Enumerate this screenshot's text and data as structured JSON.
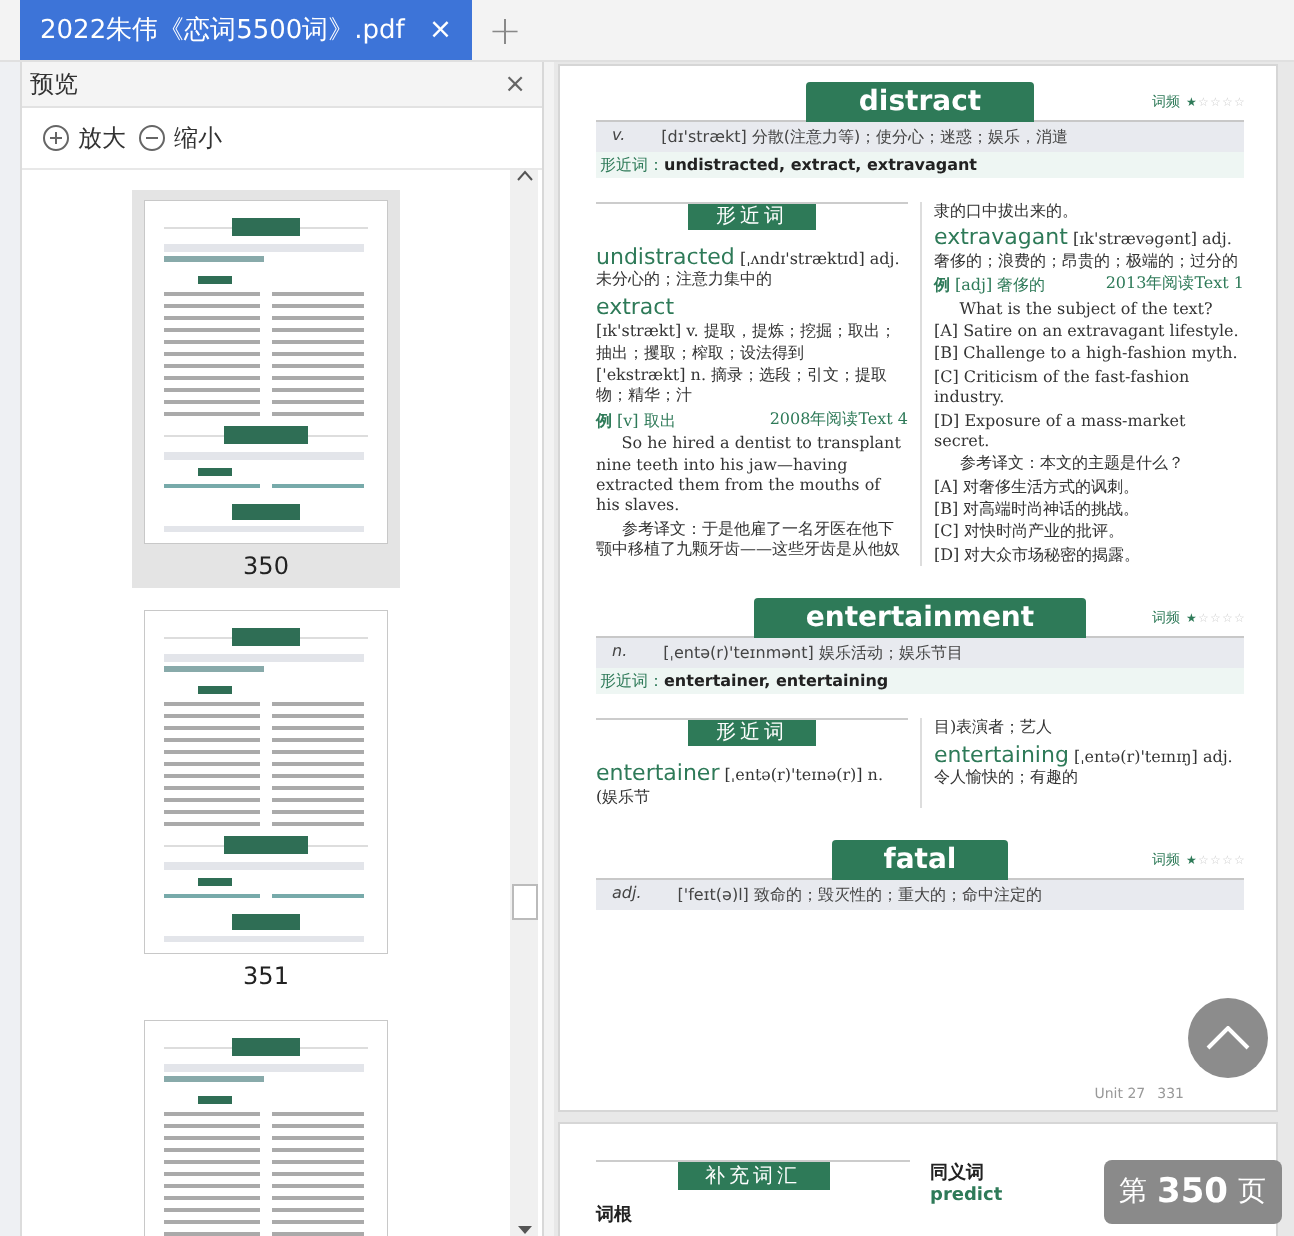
{
  "tab_bar": {
    "tabs": [
      {
        "title": "2022朱伟《恋词5500词》.pdf",
        "close": "×",
        "selected": true
      }
    ],
    "new_tab": "+"
  },
  "preview_panel": {
    "title": "预览",
    "close": "×",
    "zoom_in": "放大",
    "zoom_out": "缩小",
    "thumbnails": [
      {
        "label": "350",
        "selected": true
      },
      {
        "label": "351",
        "selected": false
      },
      {
        "selected": false
      }
    ]
  },
  "document": {
    "pages": [
      {
        "entries": [
          {
            "word": "distract",
            "freq_label": "词频",
            "stars": 1,
            "definitions": [
              {
                "pos": "v.",
                "text": "[dɪ'strækt] 分散(注意力等)；使分心；迷惑；娱乐，消遣"
              }
            ],
            "similar_label": "形近词：",
            "similar": "undistracted, extract, extravagant",
            "section_title": "形近词",
            "left": [
              {
                "kind": "word",
                "word": "undistracted",
                "text": " [ˌʌndɪ'stræktɪd] adj. 未分心的；注意力集中的"
              },
              {
                "kind": "word",
                "word": "extract"
              },
              {
                "kind": "line",
                "text": "[ɪk'strækt] v. 提取，提炼；挖掘；取出；抽出；攫取；榨取；设法得到"
              },
              {
                "kind": "line",
                "text": "['ekstrækt] n. 摘录；选段；引文；提取物；精华；汁"
              },
              {
                "kind": "example",
                "mark": "例",
                "text": "[v] 取出",
                "source": "2008年阅读Text 4"
              },
              {
                "kind": "para",
                "text": "So he hired a dentist to transplant nine teeth into his jaw—having extracted them from the mouths of his slaves."
              },
              {
                "kind": "para",
                "text": "参考译文：于是他雇了一名牙医在他下颚中移植了九颗牙齿——这些牙齿是从他奴"
              }
            ],
            "right": [
              {
                "kind": "line",
                "text": "隶的口中拔出来的。"
              },
              {
                "kind": "word",
                "word": "extravagant",
                "text": " [ɪk'strævəgənt] adj. 奢侈的；浪费的；昂贵的；极端的；过分的"
              },
              {
                "kind": "example",
                "mark": "例",
                "text": "[adj] 奢侈的",
                "source": "2013年阅读Text 1"
              },
              {
                "kind": "para",
                "text": "What is the subject of the text?"
              },
              {
                "kind": "line",
                "text": "[A] Satire on an extravagant lifestyle."
              },
              {
                "kind": "line",
                "text": "[B] Challenge to a high-fashion myth."
              },
              {
                "kind": "line",
                "text": "[C] Criticism of the fast-fashion industry."
              },
              {
                "kind": "line",
                "text": "[D] Exposure of a mass-market secret."
              },
              {
                "kind": "para",
                "text": "参考译文：本文的主题是什么？"
              },
              {
                "kind": "line",
                "text": "[A] 对奢侈生活方式的讽刺。"
              },
              {
                "kind": "line",
                "text": "[B] 对高端时尚神话的挑战。"
              },
              {
                "kind": "line",
                "text": "[C] 对快时尚产业的批评。"
              },
              {
                "kind": "line",
                "text": "[D] 对大众市场秘密的揭露。"
              }
            ]
          },
          {
            "word": "entertainment",
            "freq_label": "词频",
            "stars": 1,
            "definitions": [
              {
                "pos": "n.",
                "text": "[ˌentə(r)'teɪnmənt] 娱乐活动；娱乐节目"
              }
            ],
            "similar_label": "形近词：",
            "similar": "entertainer, entertaining",
            "section_title": "形近词",
            "left": [
              {
                "kind": "word",
                "word": "entertainer",
                "text": " [ˌentə(r)'teɪnə(r)] n. (娱乐节"
              }
            ],
            "right": [
              {
                "kind": "line",
                "text": "目)表演者；艺人"
              },
              {
                "kind": "word",
                "word": "entertaining",
                "text": " [ˌentə(r)'teɪnɪŋ] adj. 令人愉快的；有趣的"
              }
            ]
          },
          {
            "word": "fatal",
            "freq_label": "词频",
            "stars": 1,
            "definitions": [
              {
                "pos": "adj.",
                "text": "['feɪt(ə)l] 致命的；毁灭性的；重大的；命中注定的"
              }
            ]
          }
        ],
        "footer": {
          "unit": "Unit 27",
          "number": "331"
        }
      },
      {
        "section_title": "补充词汇",
        "left_heading": "词根",
        "right_heading": "同义词",
        "right_word": "predict"
      }
    ]
  },
  "page_badge": {
    "prefix": "第",
    "number": "350",
    "suffix": "页"
  }
}
